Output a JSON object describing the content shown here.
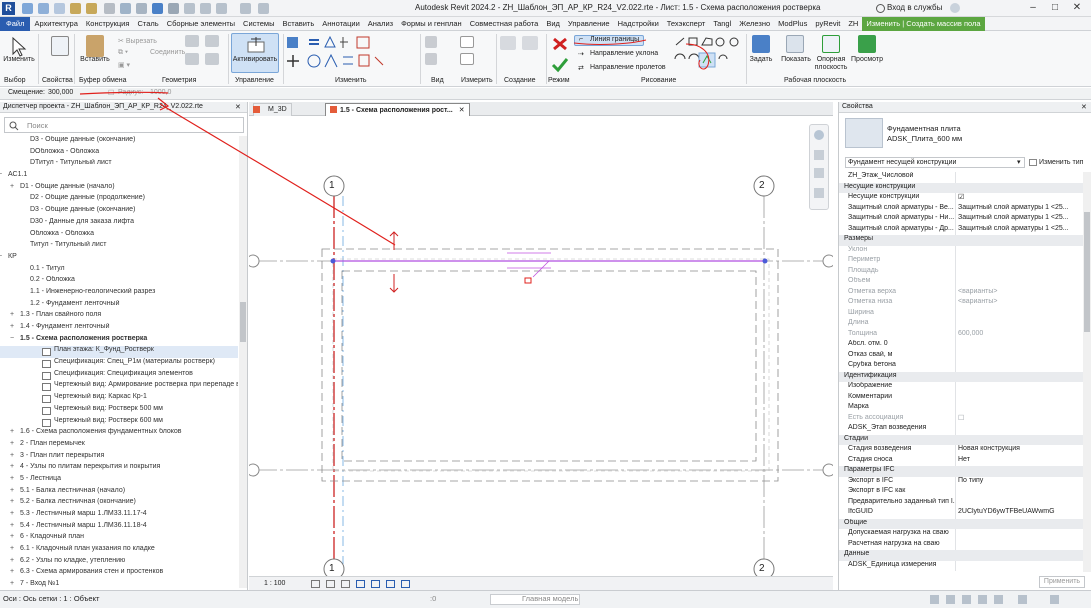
{
  "window": {
    "title": "Autodesk Revit 2024.2 - ZH_Шаблон_ЭП_АР_КР_R24_V2.022.rte - Лист: 1.5 - Схема расположения ростверка",
    "login": "Вход в службы",
    "logo": "R"
  },
  "menu": [
    "Файл",
    "Архитектура",
    "Конструкция",
    "Сталь",
    "Сборные элементы",
    "Системы",
    "Вставить",
    "Аннотации",
    "Анализ",
    "Формы и генплан",
    "Совместная работа",
    "Вид",
    "Управление",
    "Надстройки",
    "Техэксперт",
    "Tangl",
    "Железно",
    "ModPlus",
    "pyRevit",
    "ZH",
    "Изменить | Создать массив пола"
  ],
  "ribbon": {
    "modify": "Изменить",
    "paste": "Вставить",
    "cut": "Вырезать",
    "join": "Соединить",
    "activate": "Активировать",
    "boundary_line": "Линия границы",
    "slope_arrow": "Направление уклона",
    "span_direction": "Направление пролетов",
    "set": "Задать",
    "show": "Показать",
    "ref_plane": "Опорная плоскость",
    "viewer": "Просмотр",
    "panels": {
      "select": "Выбор",
      "properties": "Свойства",
      "clipboard": "Буфер обмена",
      "geometry": "Геометрия",
      "control": "Управление",
      "modify": "Изменить",
      "view": "Вид",
      "measure": "Измерить",
      "create": "Создание",
      "mode": "Режим",
      "draw": "Рисование",
      "workplane": "Рабочая плоскость"
    }
  },
  "options": {
    "offset_label": "Смещение:",
    "offset_value": "300,000",
    "radius_label": "Радиус:",
    "radius_value": "1000,0"
  },
  "project_browser": {
    "title": "Диспетчер проекта - ZH_Шаблон_ЭП_АР_КР_R24_V2.022.rte",
    "search_placeholder": "Поиск",
    "items": [
      {
        "text": "D3 - Общие данные (окончание)",
        "level": 3,
        "exp": ""
      },
      {
        "text": "DОбложка - Обложка",
        "level": 3,
        "exp": ""
      },
      {
        "text": "DТитул - Титульный лист",
        "level": 3,
        "exp": ""
      },
      {
        "text": "АС1.1",
        "level": 1,
        "exp": "−"
      },
      {
        "text": "D1 - Общие данные (начало)",
        "level": 2,
        "exp": "+"
      },
      {
        "text": "D2 - Общие данные (продолжение)",
        "level": 3,
        "exp": ""
      },
      {
        "text": "D3 - Общие данные (окончание)",
        "level": 3,
        "exp": ""
      },
      {
        "text": "D30 - Данные для заказа лифта",
        "level": 3,
        "exp": ""
      },
      {
        "text": "Обложка - Обложка",
        "level": 3,
        "exp": ""
      },
      {
        "text": "Титул - Титульный лист",
        "level": 3,
        "exp": ""
      },
      {
        "text": "КР",
        "level": 1,
        "exp": "−"
      },
      {
        "text": "0.1 - Титул",
        "level": 3,
        "exp": ""
      },
      {
        "text": "0.2 - Обложка",
        "level": 3,
        "exp": ""
      },
      {
        "text": "1.1 - Инженерно-геологический разрез",
        "level": 3,
        "exp": ""
      },
      {
        "text": "1.2 - Фундамент ленточный",
        "level": 3,
        "exp": ""
      },
      {
        "text": "1.3 - План свайного поля",
        "level": 2,
        "exp": "+"
      },
      {
        "text": "1.4 - Фундамент ленточный",
        "level": 2,
        "exp": "+"
      },
      {
        "text": "1.5 - Схема расположения ростверка",
        "level": 2,
        "exp": "−",
        "bold": true
      },
      {
        "text": "План этажа: К_Фунд_Ростверк",
        "level": 4,
        "exp": "",
        "icon": true,
        "sel": true
      },
      {
        "text": "Спецификация: Спец_Р1м (материалы ростверк)",
        "level": 4,
        "exp": "",
        "icon": true
      },
      {
        "text": "Спецификация: Спецификация элементов",
        "level": 4,
        "exp": "",
        "icon": true
      },
      {
        "text": "Чертежный вид: Армирование ростверка при перепаде в",
        "level": 4,
        "exp": "",
        "icon": true
      },
      {
        "text": "Чертежный вид: Каркас Кр-1",
        "level": 4,
        "exp": "",
        "icon": true
      },
      {
        "text": "Чертежный вид: Ростверк 500 мм",
        "level": 4,
        "exp": "",
        "icon": true
      },
      {
        "text": "Чертежный вид: Ростверк 600 мм",
        "level": 4,
        "exp": "",
        "icon": true
      },
      {
        "text": "1.6 - Схема расположения фундаментных блоков",
        "level": 2,
        "exp": "+"
      },
      {
        "text": "2 - План перемычек",
        "level": 2,
        "exp": "+"
      },
      {
        "text": "3 - План плит перекрытия",
        "level": 2,
        "exp": "+"
      },
      {
        "text": "4 - Узлы по плитам перекрытия и покрытия",
        "level": 2,
        "exp": "+"
      },
      {
        "text": "5 - Лестница",
        "level": 2,
        "exp": "+"
      },
      {
        "text": "5.1 - Балка лестничная (начало)",
        "level": 2,
        "exp": "+"
      },
      {
        "text": "5.2 - Балка лестничная (окончание)",
        "level": 2,
        "exp": "+"
      },
      {
        "text": "5.3 - Лестничный марш 1.ЛМ33.11.17-4",
        "level": 2,
        "exp": "+"
      },
      {
        "text": "5.4 - Лестничный марш 1.ЛМ36.11.18-4",
        "level": 2,
        "exp": "+"
      },
      {
        "text": "6 - Кладочный план",
        "level": 2,
        "exp": "+"
      },
      {
        "text": "6.1 - Кладочный план указания по кладке",
        "level": 2,
        "exp": "+"
      },
      {
        "text": "6.2 - Узлы по кладке, утеплению",
        "level": 2,
        "exp": "+"
      },
      {
        "text": "6.3 - Схема армирования стен и простенков",
        "level": 2,
        "exp": "+"
      },
      {
        "text": "7 - Вход №1",
        "level": 2,
        "exp": "+"
      }
    ]
  },
  "tabs": [
    {
      "label": "М_3D",
      "active": false
    },
    {
      "label": "1.5 - Схема расположения рост...",
      "active": true
    }
  ],
  "canvas": {
    "grid1": "1",
    "grid2": "2"
  },
  "viewbar": {
    "scale": "1 : 100",
    "model": "Главная модель"
  },
  "properties": {
    "title": "Свойства",
    "type_name": "Фундаментная плита",
    "type_sub": "ADSK_Плита_600 мм",
    "category": "Фундамент несущей конструкции",
    "edit_type": "Изменить тип",
    "apply": "Применить",
    "rows": [
      {
        "k": "ZH_Этаж_Числовой",
        "v": "",
        "g": false
      },
      {
        "k": "Несущие конструкции",
        "g": true
      },
      {
        "k": "Несущие конструкции",
        "v": "☑",
        "g": false
      },
      {
        "k": "Защитный слой арматуры - Ве...",
        "v": "Защитный слой арматуры 1 <25...",
        "g": false
      },
      {
        "k": "Защитный слой арматуры - Ни...",
        "v": "Защитный слой арматуры 1 <25...",
        "g": false
      },
      {
        "k": "Защитный слой арматуры - Др...",
        "v": "Защитный слой арматуры 1 <25...",
        "g": false
      },
      {
        "k": "Размеры",
        "g": true
      },
      {
        "k": "Уклон",
        "v": "",
        "grey": true
      },
      {
        "k": "Периметр",
        "v": "",
        "grey": true
      },
      {
        "k": "Площадь",
        "v": "",
        "grey": true
      },
      {
        "k": "Объем",
        "v": "",
        "grey": true
      },
      {
        "k": "Отметка верха",
        "v": "<варианты>",
        "grey": true
      },
      {
        "k": "Отметка низа",
        "v": "<варианты>",
        "grey": true
      },
      {
        "k": "Ширина",
        "v": "",
        "grey": true
      },
      {
        "k": "Длина",
        "v": "",
        "grey": true
      },
      {
        "k": "Толщина",
        "v": "600,000",
        "grey": true
      },
      {
        "k": "Абсл. отм. 0",
        "v": ""
      },
      {
        "k": "Отказ свай, м",
        "v": ""
      },
      {
        "k": "Срубка бетона",
        "v": ""
      },
      {
        "k": "Идентификация",
        "g": true
      },
      {
        "k": "Изображение",
        "v": ""
      },
      {
        "k": "Комментарии",
        "v": ""
      },
      {
        "k": "Марка",
        "v": ""
      },
      {
        "k": "Есть ассоциация",
        "v": "☐",
        "grey": true
      },
      {
        "k": "ADSK_Этап возведения",
        "v": ""
      },
      {
        "k": "Стадии",
        "g": true
      },
      {
        "k": "Стадия возведения",
        "v": "Новая конструкция"
      },
      {
        "k": "Стадия сноса",
        "v": "Нет"
      },
      {
        "k": "Параметры IFC",
        "g": true
      },
      {
        "k": "Экспорт в IFC",
        "v": "По типу"
      },
      {
        "k": "Экспорт в IFC как",
        "v": ""
      },
      {
        "k": "Предварительно заданный тип I...",
        "v": ""
      },
      {
        "k": "IfcGUID",
        "v": "2UClytuYD6ywTFBeUAWwmG"
      },
      {
        "k": "Общие",
        "g": true
      },
      {
        "k": "Допускаемая нагрузка на сваю",
        "v": ""
      },
      {
        "k": "Расчетная нагрузка на сваю",
        "v": ""
      },
      {
        "k": "Данные",
        "g": true
      },
      {
        "k": "ADSK_Единица измерения",
        "v": ""
      }
    ]
  },
  "status": {
    "left": "Оси : Ось сетки : 1 : Объект",
    "zero": ":0"
  },
  "colors": {
    "accent": "#2a5db0",
    "context_tab": "#5ca641",
    "annotation": "#e0201c",
    "edit_line": "#c050e0"
  }
}
